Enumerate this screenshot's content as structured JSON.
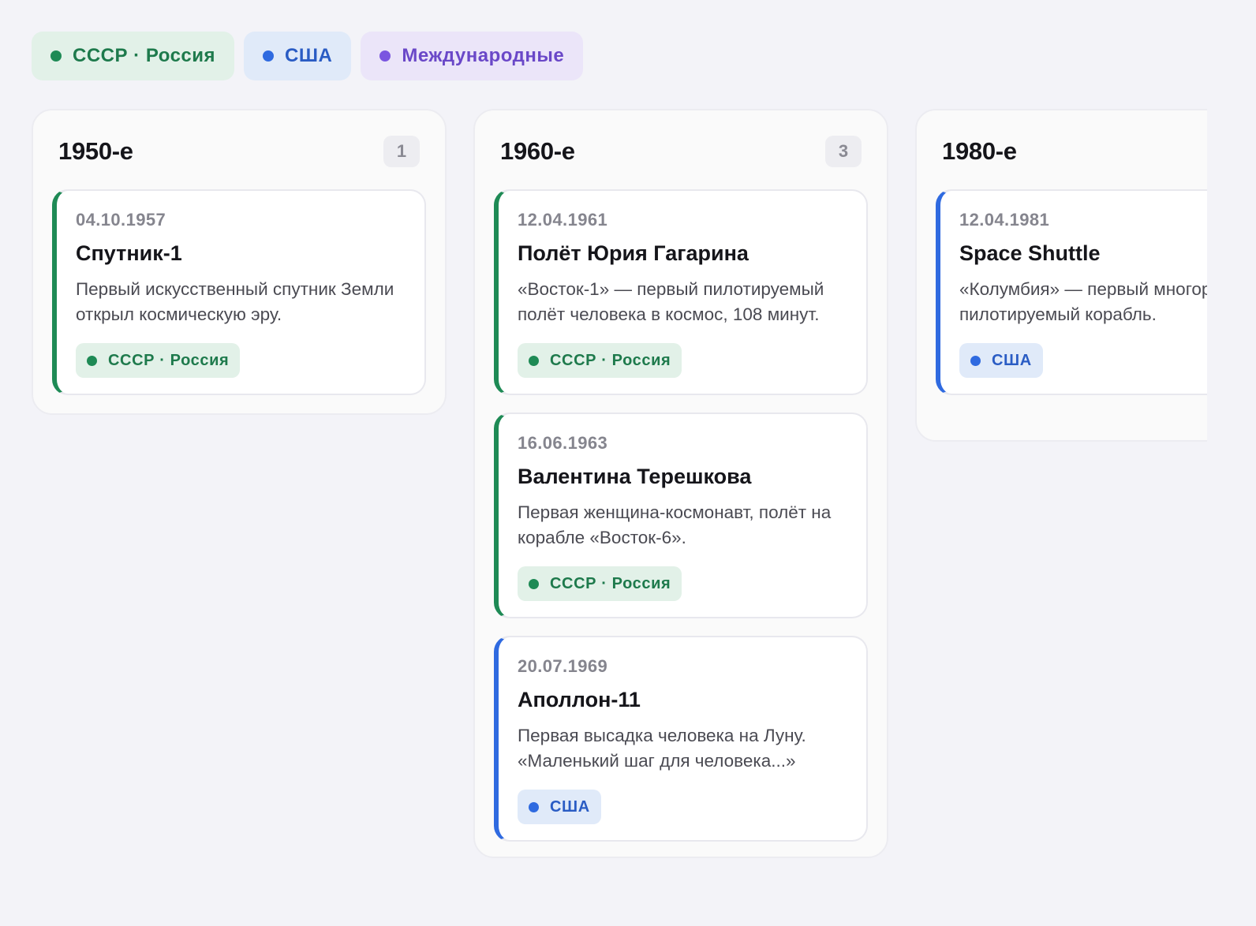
{
  "filters": [
    {
      "label": "СССР · Россия",
      "kind": "ussr",
      "color": "#1e8a55"
    },
    {
      "label": "США",
      "kind": "usa",
      "color": "#2f6ae0"
    },
    {
      "label": "Международные",
      "kind": "intl",
      "color": "#7a55e0"
    }
  ],
  "columns": [
    {
      "title": "1950-е",
      "count": "1",
      "cards": [
        {
          "date": "04.10.1957",
          "title": "Спутник-1",
          "desc": "Первый искусственный спутник Земли открыл космическую эру.",
          "tag": "СССР · Россия",
          "kind": "ussr"
        }
      ]
    },
    {
      "title": "1960-е",
      "count": "3",
      "cards": [
        {
          "date": "12.04.1961",
          "title": "Полёт Юрия Гагарина",
          "desc": "«Восток-1» — первый пилотируемый полёт человека в космос, 108 минут.",
          "tag": "СССР · Россия",
          "kind": "ussr"
        },
        {
          "date": "16.06.1963",
          "title": "Валентина Терешкова",
          "desc": "Первая женщина-космонавт, полёт на корабле «Восток-6».",
          "tag": "СССР · Россия",
          "kind": "ussr"
        },
        {
          "date": "20.07.1969",
          "title": "Аполлон-11",
          "desc": "Первая высадка человека на Луну. «Маленький шаг для человека...»",
          "tag": "США",
          "kind": "usa"
        }
      ]
    },
    {
      "title": "1980-е",
      "count": "",
      "cards": [
        {
          "date": "12.04.1981",
          "title": "Space Shuttle",
          "desc": "«Колумбия» — первый многоразовый пилотируемый корабль.",
          "tag": "США",
          "kind": "usa"
        }
      ]
    }
  ]
}
